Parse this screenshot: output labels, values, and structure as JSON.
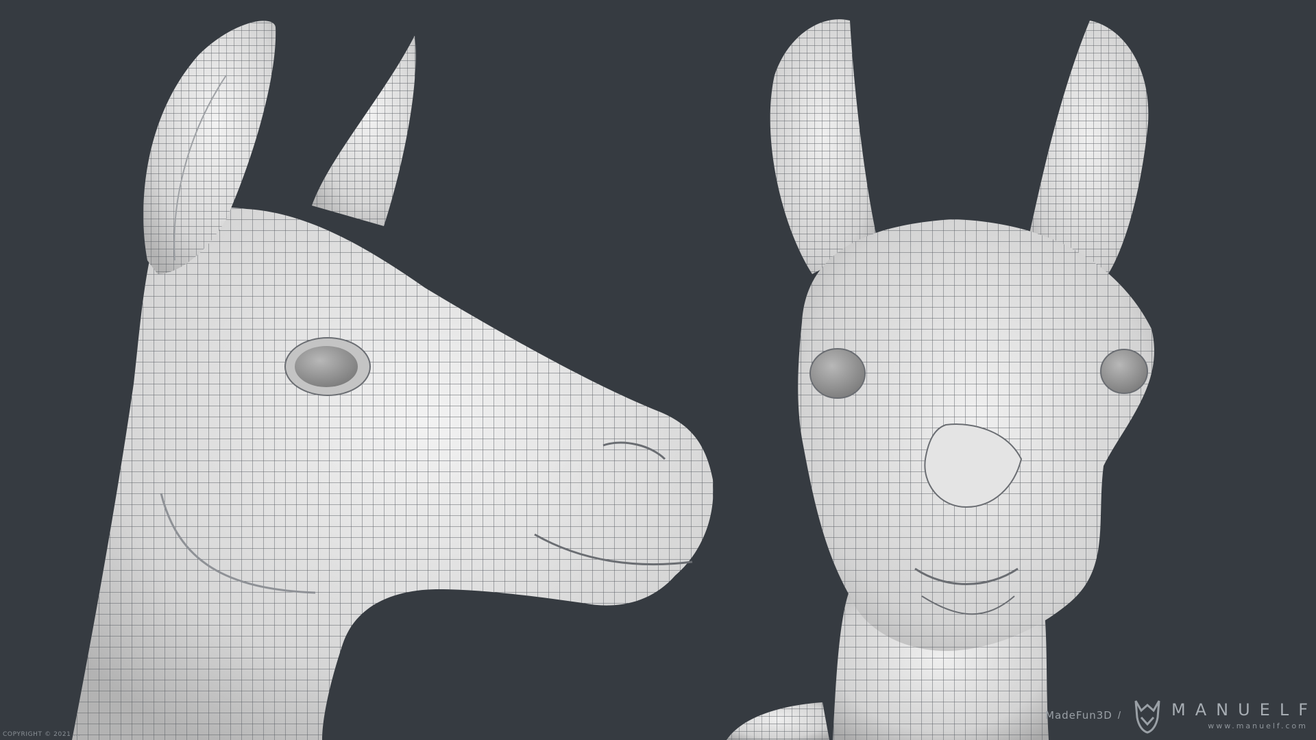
{
  "scene": {
    "background_color": "#363b41",
    "mesh_color": "#dcdcdc",
    "wire_color": "#5a5d62",
    "views": [
      {
        "name": "side-view",
        "subject": "llama head wireframe side view"
      },
      {
        "name": "front-view",
        "subject": "llama head wireframe front view"
      }
    ]
  },
  "footer": {
    "copyright": "COPYRIGHT © 2021 ...",
    "made_label": "MadeFun3D",
    "separator": "/",
    "brand_name": "MANUELF",
    "brand_url": "www.manuelf.com"
  }
}
